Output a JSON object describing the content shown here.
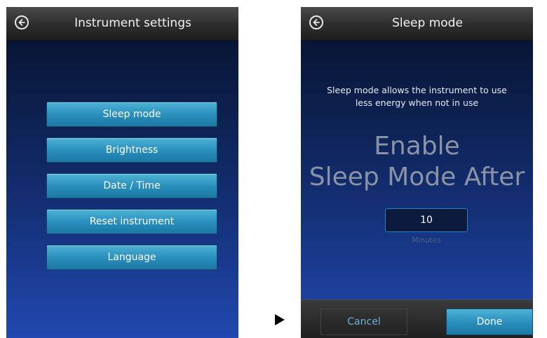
{
  "left_screen": {
    "title": "Instrument settings",
    "menu": [
      {
        "label": "Sleep mode"
      },
      {
        "label": "Brightness"
      },
      {
        "label": "Date / Time"
      },
      {
        "label": "Reset instrument"
      },
      {
        "label": "Language"
      }
    ]
  },
  "right_screen": {
    "title": "Sleep mode",
    "description_line1": "Sleep mode allows the instrument to use",
    "description_line2": "less energy when not in use",
    "heading_line1": "Enable",
    "heading_line2": "Sleep Mode After",
    "minutes_value": "10",
    "minutes_unit": "Minutes",
    "cancel_label": "Cancel",
    "done_label": "Done"
  },
  "icons": {
    "back": "back-arrow-circle-icon",
    "transition": "play-arrow-icon"
  },
  "colors": {
    "button_blue": "#2a90bd",
    "background_navy": "#0c1f4c",
    "titlebar_gray": "#2d2d2d",
    "cancel_text": "#6fb0d4"
  }
}
